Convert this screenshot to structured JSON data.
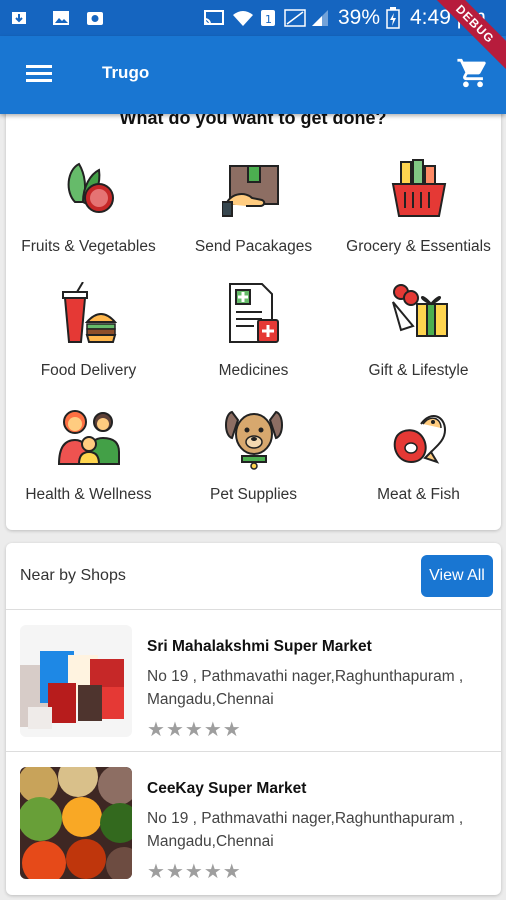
{
  "status_bar": {
    "battery": "39%",
    "time": "4:49 pm",
    "ribbon": "DEBUG"
  },
  "app_bar": {
    "title": "Trugo",
    "menu_icon": "menu-icon",
    "cart_icon": "shopping-cart-icon",
    "color": "#1976d2"
  },
  "categories": {
    "heading": "What do you want to get done?",
    "items": [
      {
        "label": "Fruits & Vegetables",
        "icon": "vegetables-icon"
      },
      {
        "label": "Send Pacakages",
        "icon": "package-icon"
      },
      {
        "label": "Grocery & Essentials",
        "icon": "grocery-basket-icon"
      },
      {
        "label": "Food Delivery",
        "icon": "food-delivery-icon"
      },
      {
        "label": "Medicines",
        "icon": "medicine-icon"
      },
      {
        "label": "Gift & Lifestyle",
        "icon": "gift-icon"
      },
      {
        "label": "Health & Wellness",
        "icon": "family-icon"
      },
      {
        "label": "Pet Supplies",
        "icon": "dog-icon"
      },
      {
        "label": "Meat & Fish",
        "icon": "meat-fish-icon"
      }
    ]
  },
  "nearby": {
    "title": "Near by Shops",
    "view_all": "View All",
    "shops": [
      {
        "name": "Sri Mahalakshmi Super Market",
        "address": "No 19 , Pathmavathi nager,Raghunthapuram , Mangadu,Chennai",
        "rating": 0,
        "max_rating": 5
      },
      {
        "name": "CeeKay Super Market",
        "address": "No 19 , Pathmavathi nager,Raghunthapuram , Mangadu,Chennai",
        "rating": 0,
        "max_rating": 5
      }
    ]
  }
}
